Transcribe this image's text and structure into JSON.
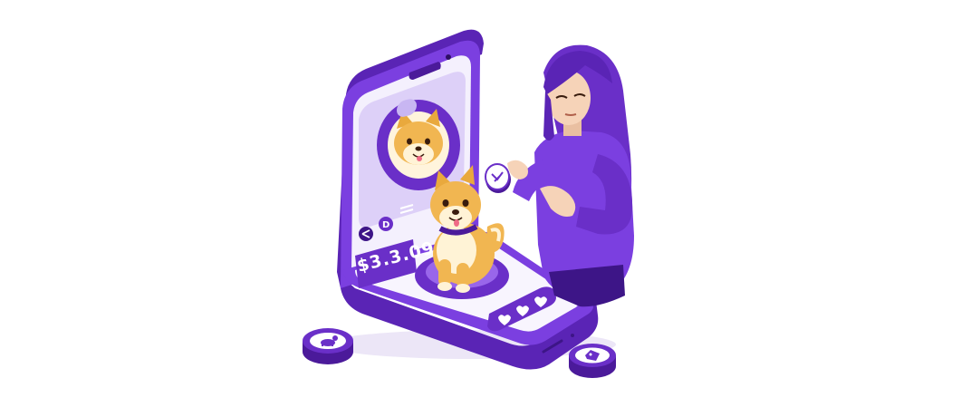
{
  "phone": {
    "price": "$3.3.09"
  },
  "colors": {
    "brand_purple": "#6a2fc8",
    "deep_purple": "#4b1a9a",
    "light_lavender": "#e9e1fb",
    "shiba_orange": "#f1b651",
    "shiba_cream": "#fff3d6",
    "skin": "#f6d3b8"
  },
  "icons": {
    "profile_image": "shiba-inu-avatar",
    "dog": "shiba-inu-dog",
    "coin_left": "dog-coin",
    "coin_right": "dog-coin",
    "coin_hand": "dog-coin",
    "like_button": "hearts",
    "toolbar": [
      "share-icon",
      "d-icon",
      "menu-icon"
    ]
  }
}
